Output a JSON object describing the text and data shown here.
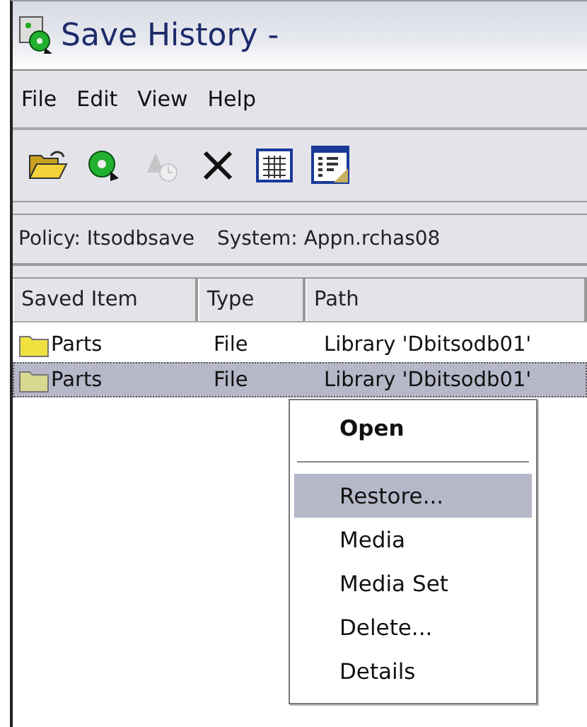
{
  "window": {
    "title": "Save History -"
  },
  "menu_bar": [
    "File",
    "Edit",
    "View",
    "Help"
  ],
  "toolbar": [
    {
      "kind": "open",
      "disabled": false
    },
    {
      "kind": "tape",
      "disabled": false
    },
    {
      "kind": "schedule",
      "disabled": true
    },
    {
      "kind": "delete",
      "disabled": false
    },
    {
      "kind": "grid",
      "disabled": false
    },
    {
      "kind": "details",
      "disabled": false
    }
  ],
  "info_bar": [
    "Policy: Itsodbsave",
    "System: Appn.rchas08"
  ],
  "table": {
    "columns": [
      "Saved Item",
      "Type",
      "Path"
    ],
    "rows": [
      {
        "cells": [
          "Parts",
          "File",
          "Library 'Dbitsodb01'"
        ],
        "selected": false
      },
      {
        "cells": [
          "Parts",
          "File",
          "Library 'Dbitsodb01'"
        ],
        "selected": true
      }
    ]
  },
  "context_menu": [
    {
      "label": "Open",
      "kind": "default",
      "selected": false
    },
    {
      "kind": "separator"
    },
    {
      "label": "Restore...",
      "kind": "item",
      "selected": true
    },
    {
      "label": "Media",
      "kind": "item",
      "selected": false
    },
    {
      "label": "Media Set",
      "kind": "item",
      "selected": false
    },
    {
      "label": "Delete...",
      "kind": "item",
      "selected": false
    },
    {
      "label": "Details",
      "kind": "item",
      "selected": false
    }
  ]
}
